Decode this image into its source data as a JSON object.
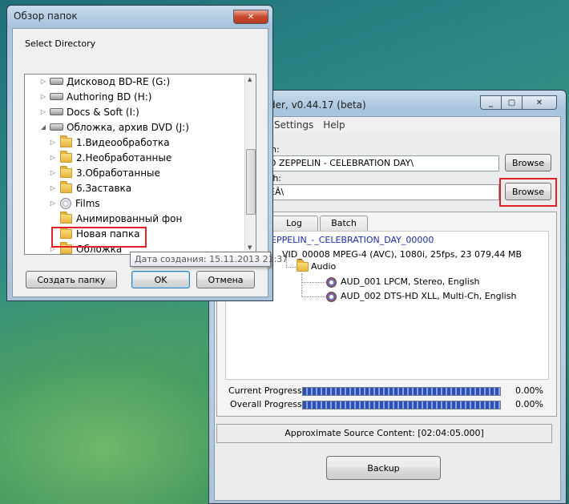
{
  "browse_dialog": {
    "title": "Обзор папок",
    "prompt": "Select Directory",
    "tree": [
      {
        "label": "Дисковод BD-RE (G:)",
        "icon": "drive-icon",
        "level": 1,
        "expander": "▷"
      },
      {
        "label": "Authoring BD (H:)",
        "icon": "drive-icon",
        "level": 1,
        "expander": "▷"
      },
      {
        "label": "Docs & Soft (I:)",
        "icon": "drive-icon",
        "level": 1,
        "expander": "▷"
      },
      {
        "label": "Обложка, архив DVD (J:)",
        "icon": "drive-icon",
        "level": 1,
        "expander": "◢"
      },
      {
        "label": "1.Видеообработка",
        "icon": "folder-icon",
        "level": 2,
        "expander": "▷"
      },
      {
        "label": "2.Необработанные",
        "icon": "folder-icon",
        "level": 2,
        "expander": "▷"
      },
      {
        "label": "3.Обработанные",
        "icon": "folder-icon",
        "level": 2,
        "expander": "▷"
      },
      {
        "label": "6.Заставка",
        "icon": "folder-icon",
        "level": 2,
        "expander": "▷"
      },
      {
        "label": "Films",
        "icon": "disc-icon",
        "level": 2,
        "expander": "▷"
      },
      {
        "label": "Анимированный фон",
        "icon": "folder-icon",
        "level": 2,
        "expander": ""
      },
      {
        "label": "Новая папка",
        "icon": "folder-icon",
        "level": 2,
        "expander": "",
        "highlighted": true
      },
      {
        "label": "Обложка",
        "icon": "folder-icon",
        "level": 2,
        "expander": "▷"
      }
    ],
    "tooltip": "Дата создания: 15.11.2013 21:37",
    "new_folder_label": "Создать папку",
    "ok_label": "OK",
    "cancel_label": "Отмена"
  },
  "main_window": {
    "title": "der, v0.44.17 (beta)",
    "menu": [
      "Settings",
      "Help"
    ],
    "source_label": "n:",
    "source_value": "D ZEPPELIN - CELEBRATION DAY\\",
    "dest_label": "th:",
    "dest_value": "ÊÂ\\",
    "browse1_label": "Browse",
    "browse2_label": "Browse",
    "tabs": [
      "Log",
      "Batch"
    ],
    "content_root": "EPPELIN_-_CELEBRATION_DAY_00000",
    "video_line": "VID_00008  MPEG-4 (AVC), 1080i, 25fps, 23 079,44 MB",
    "audio_folder": "Audio",
    "audio_tracks": [
      "AUD_001 LPCM, Stereo, English",
      "AUD_002 DTS-HD XLL, Multi-Ch, English"
    ],
    "current_progress_label": "Current Progress:",
    "current_progress_value": "0.00%",
    "overall_progress_label": "Overall Progress:",
    "overall_progress_value": "0.00%",
    "approx_content": "Approximate Source Content: [02:04:05.000]",
    "backup_label": "Backup"
  },
  "colors": {
    "highlight_box": "#e0202a",
    "link_blue": "#1a2fa0"
  }
}
